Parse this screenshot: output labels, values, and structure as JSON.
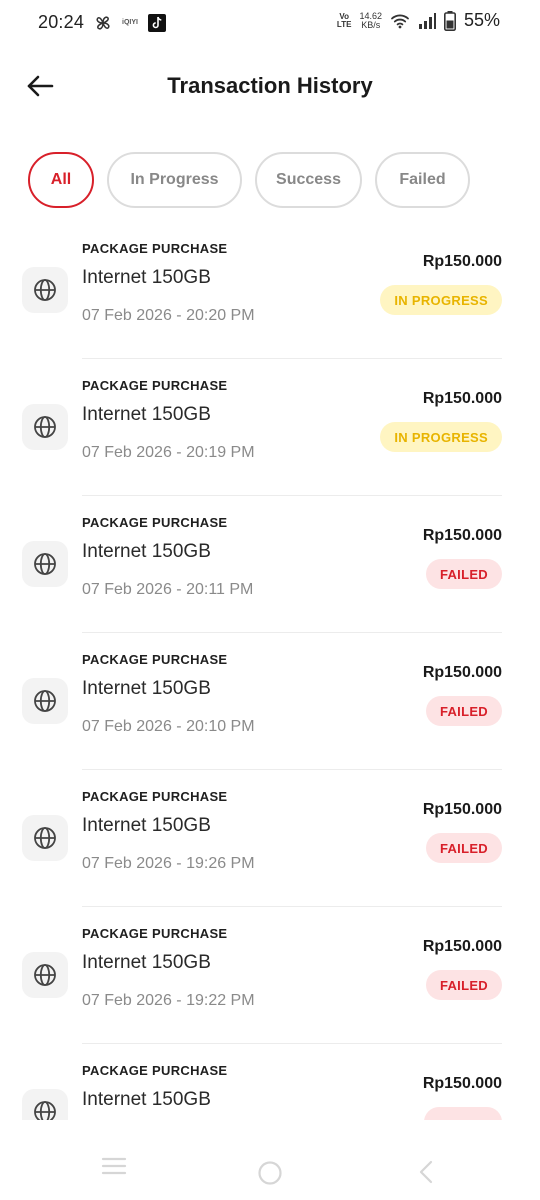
{
  "status_bar": {
    "time": "20:24",
    "app_icon_1": "pinwheel-icon",
    "app_icon_2_text": "iQIYI",
    "app_icon_3": "tiktok-icon",
    "volte_line1": "Vo",
    "volte_line2": "LTE",
    "speed_value": "14.62",
    "speed_unit": "KB/s",
    "battery_percent": "55%"
  },
  "header": {
    "back_icon": "arrow-left-icon",
    "title": "Transaction History"
  },
  "tabs": [
    {
      "label": "All",
      "active": true
    },
    {
      "label": "In Progress",
      "active": false
    },
    {
      "label": "Success",
      "active": false
    },
    {
      "label": "Failed",
      "active": false
    }
  ],
  "colors": {
    "accent_red": "#d8202a",
    "progress_text": "#e8b400",
    "progress_bg": "#fff5c2",
    "failed_bg": "#fde3e4"
  },
  "transactions": [
    {
      "icon": "globe-icon",
      "category": "PACKAGE PURCHASE",
      "name": "Internet 150GB",
      "date": "07 Feb 2026 - 20:20 PM",
      "amount": "Rp150.000",
      "status": "IN PROGRESS"
    },
    {
      "icon": "globe-icon",
      "category": "PACKAGE PURCHASE",
      "name": "Internet 150GB",
      "date": "07 Feb 2026 - 20:19 PM",
      "amount": "Rp150.000",
      "status": "IN PROGRESS"
    },
    {
      "icon": "globe-icon",
      "category": "PACKAGE PURCHASE",
      "name": "Internet 150GB",
      "date": "07 Feb 2026 - 20:11 PM",
      "amount": "Rp150.000",
      "status": "FAILED"
    },
    {
      "icon": "globe-icon",
      "category": "PACKAGE PURCHASE",
      "name": "Internet 150GB",
      "date": "07 Feb 2026 - 20:10 PM",
      "amount": "Rp150.000",
      "status": "FAILED"
    },
    {
      "icon": "globe-icon",
      "category": "PACKAGE PURCHASE",
      "name": "Internet 150GB",
      "date": "07 Feb 2026 - 19:26 PM",
      "amount": "Rp150.000",
      "status": "FAILED"
    },
    {
      "icon": "globe-icon",
      "category": "PACKAGE PURCHASE",
      "name": "Internet 150GB",
      "date": "07 Feb 2026 - 19:22 PM",
      "amount": "Rp150.000",
      "status": "FAILED"
    },
    {
      "icon": "globe-icon",
      "category": "PACKAGE PURCHASE",
      "name": "Internet 150GB",
      "date": "",
      "amount": "Rp150.000",
      "status": ""
    }
  ],
  "navbar": {
    "recents_icon": "recents-icon",
    "home_icon": "home-circle-icon",
    "back_icon": "back-chevron-icon"
  }
}
